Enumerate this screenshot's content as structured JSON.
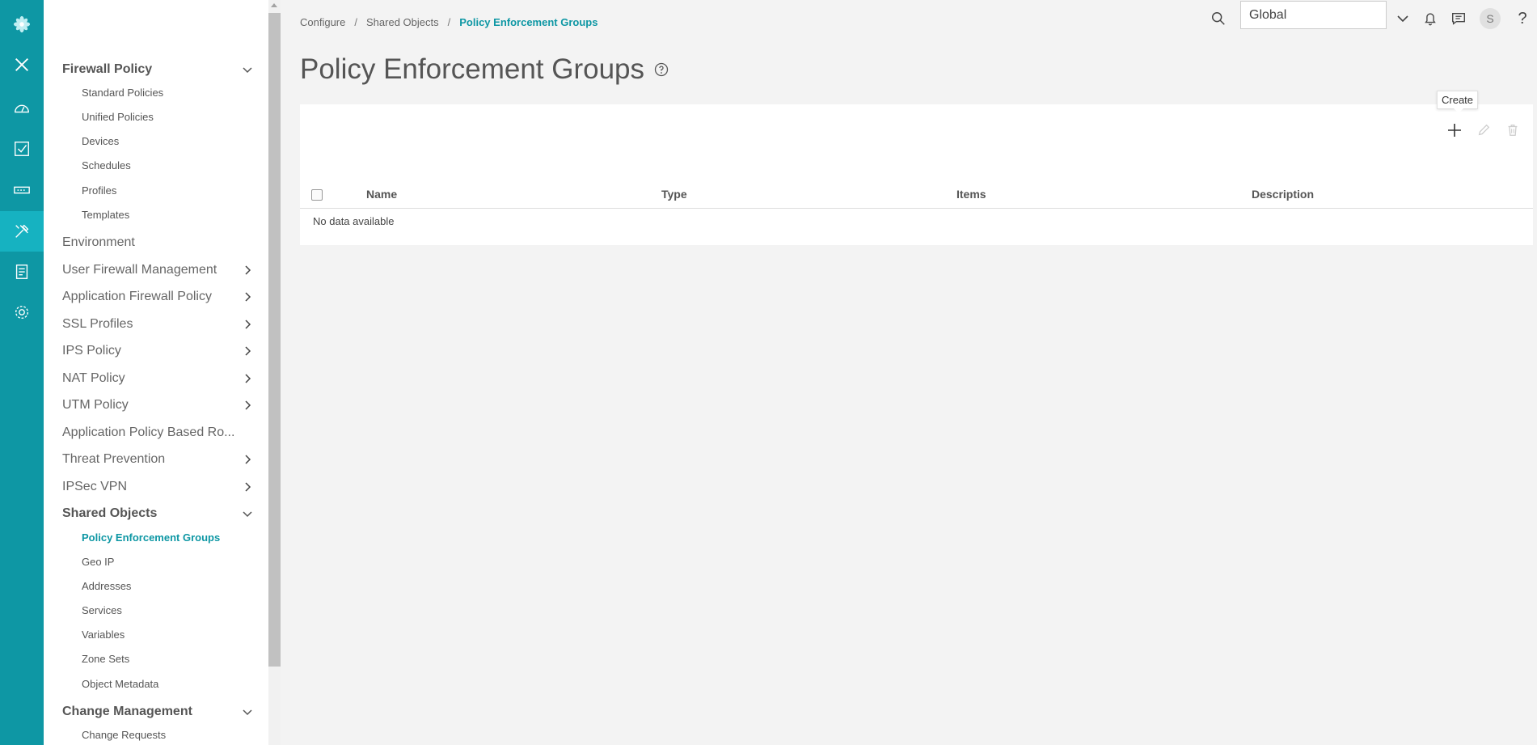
{
  "rail": {
    "items": [
      {
        "name": "logo-icon"
      },
      {
        "name": "close-icon"
      },
      {
        "name": "dashboard-icon"
      },
      {
        "name": "monitor-icon"
      },
      {
        "name": "devices-icon"
      },
      {
        "name": "configure-icon",
        "active": true
      },
      {
        "name": "reports-icon"
      },
      {
        "name": "administration-icon"
      }
    ]
  },
  "nav": {
    "firewall_policy": {
      "label": "Firewall Policy",
      "items": [
        "Standard Policies",
        "Unified Policies",
        "Devices",
        "Schedules",
        "Profiles",
        "Templates"
      ]
    },
    "environment": "Environment",
    "user_firewall": "User Firewall Management",
    "app_firewall": "Application Firewall Policy",
    "ssl_profiles": "SSL Profiles",
    "ips_policy": "IPS Policy",
    "nat_policy": "NAT Policy",
    "utm_policy": "UTM Policy",
    "app_routing": "Application Policy Based Ro...",
    "threat_prevention": "Threat Prevention",
    "ipsec_vpn": "IPSec VPN",
    "shared_objects": {
      "label": "Shared Objects",
      "items": [
        "Policy Enforcement Groups",
        "Geo IP",
        "Addresses",
        "Services",
        "Variables",
        "Zone Sets",
        "Object Metadata"
      ]
    },
    "change_management": {
      "label": "Change Management",
      "items": [
        "Change Requests"
      ]
    }
  },
  "breadcrumb": {
    "configure": "Configure",
    "shared_objects": "Shared Objects",
    "current": "Policy Enforcement Groups",
    "separator": "/"
  },
  "header": {
    "scope": "Global",
    "user_initial": "S",
    "help": "?"
  },
  "page": {
    "title": "Policy Enforcement Groups"
  },
  "toolbar": {
    "tooltip": "Create"
  },
  "table": {
    "columns": [
      "Name",
      "Type",
      "Items",
      "Description"
    ],
    "empty_message": "No data available"
  },
  "colors": {
    "brand": "#0e97a4",
    "rail_active": "#16b2c1"
  }
}
